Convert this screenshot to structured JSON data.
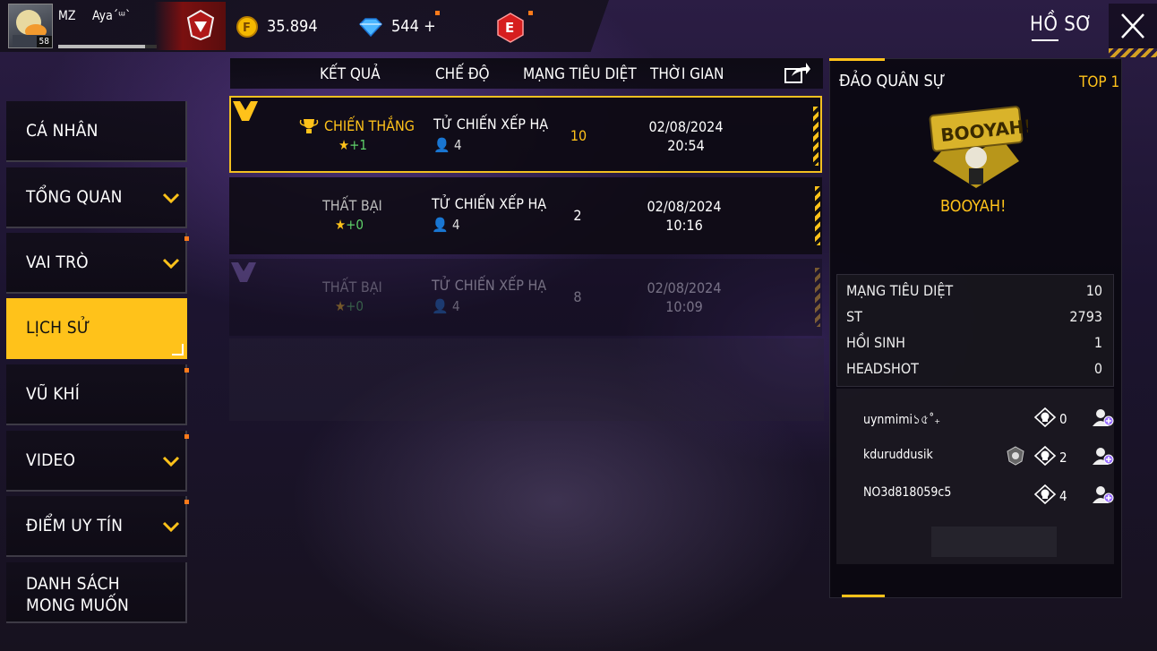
{
  "header": {
    "player_name_1": "MZ",
    "player_name_2": "Aya´ᵚ`",
    "level": "58",
    "xp_fraction": 0.88,
    "coins": "35.894",
    "diamonds": "544",
    "diamond_plus": "+",
    "elite_letter": "E",
    "page_title": "HỒ SƠ"
  },
  "sidebar": {
    "items": [
      {
        "label": "CÁ NHÂN",
        "has_chevron": false,
        "has_dot": false
      },
      {
        "label": "TỔNG QUAN",
        "has_chevron": true,
        "has_dot": false
      },
      {
        "label": "VAI TRÒ",
        "has_chevron": true,
        "has_dot": true
      },
      {
        "label": "LỊCH SỬ",
        "has_chevron": false,
        "has_dot": false,
        "active": true
      },
      {
        "label": "VŨ KHÍ",
        "has_chevron": false,
        "has_dot": true
      },
      {
        "label": "VIDEO",
        "has_chevron": true,
        "has_dot": true
      },
      {
        "label": "ĐIỂM UY TÍN",
        "has_chevron": true,
        "has_dot": true
      },
      {
        "label_line1": "DANH SÁCH",
        "label_line2": "MONG MUỐN",
        "has_chevron": false,
        "has_dot": false
      }
    ]
  },
  "table": {
    "headers": {
      "result": "KẾT QUẢ",
      "mode": "CHẾ ĐỘ",
      "kills": "MẠNG TIÊU DIỆT",
      "time": "THỜI GIAN"
    },
    "rows": [
      {
        "result": "CHIẾN THẮNG",
        "stars": "+1",
        "mode": "TỬ CHIẾN XẾP HẠ",
        "players": "4",
        "kills": "10",
        "date": "02/08/2024",
        "time": "20:54"
      },
      {
        "result": "THẤT BẠI",
        "stars": "+0",
        "mode": "TỬ CHIẾN XẾP HẠ",
        "players": "4",
        "kills": "2",
        "date": "02/08/2024",
        "time": "10:16"
      },
      {
        "result": "THẤT BẠI",
        "stars": "+0",
        "mode": "TỬ CHIẾN XẾP HẠ",
        "players": "4",
        "kills": "8",
        "date": "02/08/2024",
        "time": "10:09"
      }
    ]
  },
  "detail": {
    "map_name": "ĐẢO QUÂN SỰ",
    "rank": "TOP 1",
    "booyah_text": "BOOYAH!",
    "booyah_badge_text": "BOOYAH!",
    "stats": [
      {
        "label": "MẠNG TIÊU DIỆT",
        "value": "10"
      },
      {
        "label": "ST",
        "value": "2793"
      },
      {
        "label": "HỒI SINH",
        "value": "1"
      },
      {
        "label": "HEADSHOT",
        "value": "0"
      }
    ],
    "teammates": [
      {
        "name": "uynmimi১৫˚₊",
        "kills": "0",
        "has_shield": false
      },
      {
        "name": "kduruddusik",
        "kills": "2",
        "has_shield": true
      },
      {
        "name": "NO3d818059c5",
        "kills": "4",
        "has_shield": false
      }
    ]
  },
  "colors": {
    "accent": "#ffc21a",
    "star_plus": "#5fd36a",
    "notif_dot": "#ff7a1a"
  }
}
